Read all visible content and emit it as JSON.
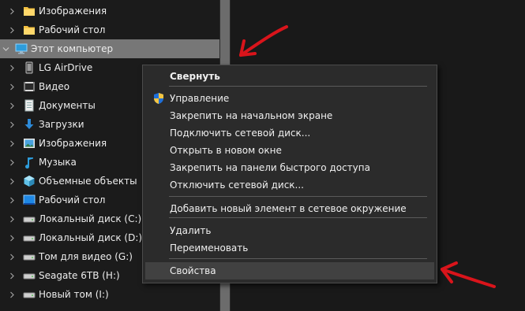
{
  "nav": {
    "items": [
      {
        "label": "Изображения",
        "icon": "folder-icon",
        "expandable": true,
        "selected": false
      },
      {
        "label": "Рабочий стол",
        "icon": "folder-icon",
        "expandable": true,
        "selected": false
      },
      {
        "label": "Этот компьютер",
        "icon": "computer-icon",
        "expandable": true,
        "expanded": true,
        "selected": true
      },
      {
        "label": "LG AirDrive",
        "icon": "phone-icon",
        "expandable": true,
        "selected": false
      },
      {
        "label": "Видео",
        "icon": "video-folder-icon",
        "expandable": true,
        "selected": false
      },
      {
        "label": "Документы",
        "icon": "documents-icon",
        "expandable": true,
        "selected": false
      },
      {
        "label": "Загрузки",
        "icon": "downloads-icon",
        "expandable": true,
        "selected": false
      },
      {
        "label": "Изображения",
        "icon": "pictures-icon",
        "expandable": true,
        "selected": false
      },
      {
        "label": "Музыка",
        "icon": "music-icon",
        "expandable": true,
        "selected": false
      },
      {
        "label": "Объемные объекты",
        "icon": "3d-objects-icon",
        "expandable": true,
        "selected": false
      },
      {
        "label": "Рабочий стол",
        "icon": "desktop-icon",
        "expandable": true,
        "selected": false
      },
      {
        "label": "Локальный диск (C:)",
        "icon": "drive-icon",
        "expandable": true,
        "selected": false
      },
      {
        "label": "Локальный диск (D:)",
        "icon": "drive-icon",
        "expandable": true,
        "selected": false
      },
      {
        "label": "Том для видео (G:)",
        "icon": "drive-icon",
        "expandable": true,
        "selected": false
      },
      {
        "label": "Seagate 6TB (H:)",
        "icon": "drive-icon",
        "expandable": true,
        "selected": false
      },
      {
        "label": "Новый том (I:)",
        "icon": "drive-icon",
        "expandable": true,
        "selected": false
      }
    ]
  },
  "context_menu": {
    "items": [
      {
        "label": "Свернуть",
        "bold": true
      },
      {
        "label": "Управление",
        "icon": "uac-shield-icon"
      },
      {
        "label": "Закрепить на начальном экране"
      },
      {
        "label": "Подключить сетевой диск..."
      },
      {
        "label": "Открыть в новом окне"
      },
      {
        "label": "Закрепить на панели быстрого доступа"
      },
      {
        "label": "Отключить сетевой диск..."
      },
      {
        "label": "Добавить новый элемент в сетевое окружение"
      },
      {
        "label": "Удалить"
      },
      {
        "label": "Переименовать"
      },
      {
        "label": "Свойства",
        "highlighted": true
      }
    ]
  },
  "annotations": {
    "arrow_color": "#d9141b"
  },
  "colors": {
    "background": "#191919",
    "selected_row": "#777777",
    "menu_bg": "#2b2b2b",
    "menu_hover": "#414141",
    "folder_yellow": "#f5c242",
    "accent_blue": "#2d9cdb"
  }
}
